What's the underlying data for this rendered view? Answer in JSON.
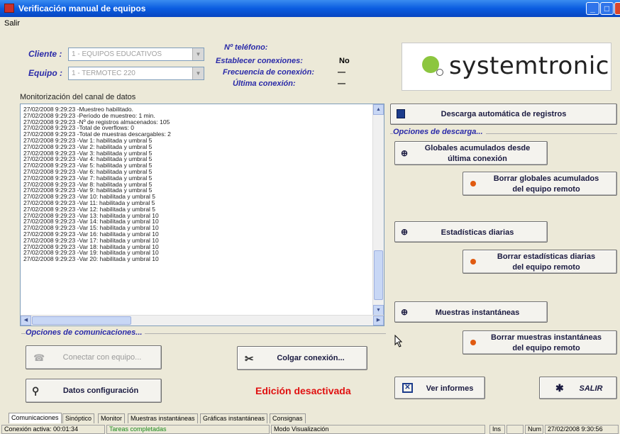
{
  "window": {
    "title": "Verificación manual de equipos",
    "menu": [
      "Salir"
    ]
  },
  "connection": {
    "cliente_label": "Cliente :",
    "cliente_value": "1 - EQUIPOS EDUCATIVOS",
    "equipo_label": "Equipo :",
    "equipo_value": "1 - TERMOTEC 220",
    "telefono_label": "Nº teléfono:",
    "establecer_label": "Establecer conexiones:",
    "establecer_value": "No",
    "frecuencia_label": "Frecuencia de conexión:",
    "frecuencia_value": "—",
    "ultima_label": "Última conexión:",
    "ultima_value": "—"
  },
  "logo": {
    "text": "systemtronic"
  },
  "monitor": {
    "label": "Monitorización del canal de datos",
    "lines": [
      "27/02/2008 9:29:23 -Muestreo habilitado.",
      "27/02/2008 9:29:23 -Período de muestreo: 1 min.",
      "27/02/2008 9:29:23 -Nº de registros almacenados: 105",
      "27/02/2008 9:29:23 -Total de overflows: 0",
      "27/02/2008 9:29:23 -Total de muestras descargables: 2",
      "27/02/2008 9:29:23 -Var 1:  habilitada y umbral 5",
      "27/02/2008 9:29:23 -Var 2:  habilitada y umbral 5",
      "27/02/2008 9:29:23 -Var 3:  habilitada y umbral 5",
      "27/02/2008 9:29:23 -Var 4:  habilitada y umbral 5",
      "27/02/2008 9:29:23 -Var 5:  habilitada y umbral 5",
      "27/02/2008 9:29:23 -Var 6:  habilitada y umbral 5",
      "27/02/2008 9:29:23 -Var 7:  habilitada y umbral 5",
      "27/02/2008 9:29:23 -Var 8:  habilitada y umbral 5",
      "27/02/2008 9:29:23 -Var 9:  habilitada y umbral 5",
      "27/02/2008 9:29:23 -Var 10:  habilitada y umbral 5",
      "27/02/2008 9:29:23 -Var 11:  habilitada y umbral 5",
      "27/02/2008 9:29:23 -Var 12:  habilitada y umbral 5",
      "27/02/2008 9:29:23 -Var 13:  habilitada y umbral 10",
      "27/02/2008 9:29:23 -Var 14:  habilitada y umbral 10",
      "27/02/2008 9:29:23 -Var 15:  habilitada y umbral 10",
      "27/02/2008 9:29:23 -Var 16:  habilitada y umbral 10",
      "27/02/2008 9:29:23 -Var 17:  habilitada y umbral 10",
      "27/02/2008 9:29:23 -Var 18:  habilitada y umbral 10",
      "27/02/2008 9:29:23 -Var 19:  habilitada y umbral 10",
      "27/02/2008 9:29:23 -Var 20:  habilitada y umbral 10"
    ]
  },
  "comms": {
    "group_label": "Opciones de comunicaciones...",
    "connect_label": "Conectar con equipo...",
    "hangup_label": "Colgar conexión...",
    "config_label": "Datos configuración",
    "edit_status": "Edición desactivada"
  },
  "download": {
    "auto_label": "Descarga automática de registros",
    "group_label": "Opciones de descarga...",
    "globales_label_1": "Globales acumulados desde",
    "globales_label_2": "última conexión",
    "borrar_globales_1": "Borrar globales acumulados",
    "borrar_globales_2": "del equipo remoto",
    "estadisticas_label": "Estadísticas diarias",
    "borrar_estadisticas_1": "Borrar estadísticas diarias",
    "borrar_estadisticas_2": "del equipo remoto",
    "muestras_label": "Muestras instantáneas",
    "borrar_muestras_1": "Borrar muestras instantáneas",
    "borrar_muestras_2": "del equipo remoto",
    "informes_label": "Ver informes",
    "salir_label": "SALIR"
  },
  "tabs": [
    "Comunicaciones",
    "Sinóptico",
    "Monitor",
    "Muestras instantáneas",
    "Gráficas instantáneas",
    "Consignas"
  ],
  "status": {
    "conexion": "Conexión activa: 00:01:34",
    "tareas": "Tareas completadas",
    "modo": "Modo Visualización",
    "ins": "Ins",
    "num": "Num",
    "datetime": "27/02/2008 9:30:56"
  }
}
